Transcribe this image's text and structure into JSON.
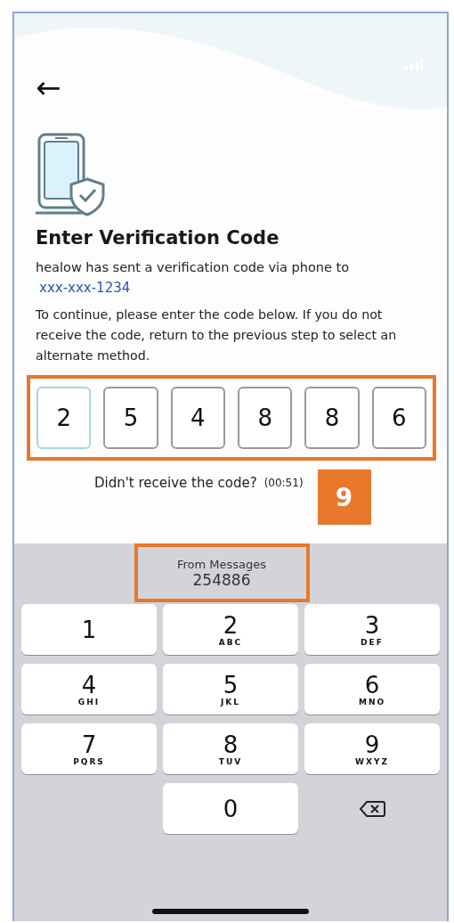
{
  "header": {
    "back": "←"
  },
  "title": "Enter Verification Code",
  "message": "healow has sent a verification code via phone to",
  "phone": "xxx-xxx-1234",
  "instructions": "To continue, please enter the code below. If you do not receive the code, return to the previous step to select an alternate method.",
  "code_cells": [
    {
      "value": "2",
      "selected": true
    },
    {
      "value": "5",
      "selected": false
    },
    {
      "value": "4",
      "selected": false
    },
    {
      "value": "8",
      "selected": false
    },
    {
      "value": "8",
      "selected": false
    },
    {
      "value": "6",
      "selected": false
    }
  ],
  "resend": {
    "prompt": "Didn't receive the code?",
    "timer": "(00:51)"
  },
  "step_badge": "9",
  "keyboard": {
    "suggestion": {
      "label": "From Messages",
      "code": "254886"
    },
    "keys": [
      {
        "kind": "digit",
        "digit": "1"
      },
      {
        "kind": "digit",
        "digit": "2",
        "letters": "ABC"
      },
      {
        "kind": "digit",
        "digit": "3",
        "letters": "DEF"
      },
      {
        "kind": "digit",
        "digit": "4",
        "letters": "GHI"
      },
      {
        "kind": "digit",
        "digit": "5",
        "letters": "JKL"
      },
      {
        "kind": "digit",
        "digit": "6",
        "letters": "MNO"
      },
      {
        "kind": "digit",
        "digit": "7",
        "letters": "PQRS"
      },
      {
        "kind": "digit",
        "digit": "8",
        "letters": "TUV"
      },
      {
        "kind": "digit",
        "digit": "9",
        "letters": "WXYZ"
      },
      {
        "kind": "digit",
        "digit": "0"
      },
      {
        "kind": "delete"
      }
    ]
  }
}
